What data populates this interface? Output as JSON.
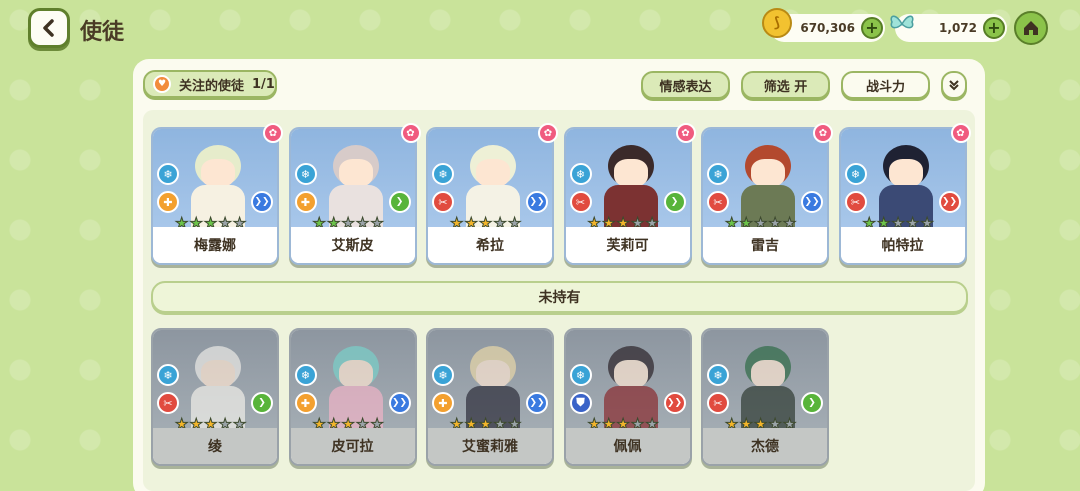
{
  "header": {
    "title": "使徒",
    "gold": "670,306",
    "gems": "1,072"
  },
  "toolbar": {
    "favorites_label": "关注的使徒",
    "favorites_count": "1/1",
    "emote_label": "情感表达",
    "filter_label": "筛选 开",
    "sort_label": "战斗力"
  },
  "owned": [
    {
      "name": "梅露娜",
      "stars": 3,
      "star_color": "green",
      "role": "orange",
      "pos": "blue",
      "hair": "#e6eccb",
      "outfit": "#f6f1e2"
    },
    {
      "name": "艾斯皮",
      "stars": 2,
      "star_color": "green",
      "role": "orange",
      "pos": "green",
      "hair": "#d7cbc9",
      "outfit": "#e9e1df"
    },
    {
      "name": "希拉",
      "stars": 3,
      "star_color": "gold",
      "role": "red",
      "pos": "blue",
      "hair": "#eef0d6",
      "outfit": "#f4f2e5"
    },
    {
      "name": "芙莉可",
      "stars": 3,
      "star_color": "gold",
      "role": "red",
      "pos": "green",
      "hair": "#3b2a2a",
      "outfit": "#7c3232"
    },
    {
      "name": "雷吉",
      "stars": 2,
      "star_color": "green",
      "role": "red",
      "pos": "blue",
      "hair": "#b3492e",
      "outfit": "#6c7a55"
    },
    {
      "name": "帕特拉",
      "stars": 2,
      "star_color": "green",
      "role": "red",
      "pos": "red",
      "hair": "#1f2233",
      "outfit": "#3b4a75"
    }
  ],
  "section_unowned": "未持有",
  "unowned": [
    {
      "name": "绫",
      "stars": 3,
      "star_color": "gold",
      "role": "red",
      "pos": "green",
      "hair": "#eceae6",
      "outfit": "#f1efe9"
    },
    {
      "name": "皮可拉",
      "stars": 3,
      "star_color": "gold",
      "role": "orange",
      "pos": "blue",
      "hair": "#7ad1c9",
      "outfit": "#f0b4c7"
    },
    {
      "name": "艾蜜莉雅",
      "stars": 3,
      "star_color": "gold",
      "role": "orange",
      "pos": "blue",
      "hair": "#e9d7a8",
      "outfit": "#2d2d3a"
    },
    {
      "name": "佩佩",
      "stars": 3,
      "star_color": "gold",
      "role": "blue",
      "pos": "red",
      "hair": "#2b2328",
      "outfit": "#8a2b2f"
    },
    {
      "name": "杰德",
      "stars": 3,
      "star_color": "gold",
      "role": "red",
      "pos": "green",
      "hair": "#2f6b46",
      "outfit": "#2f3b33"
    }
  ]
}
